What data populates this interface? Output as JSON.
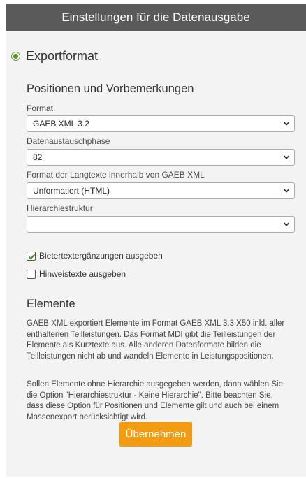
{
  "header": {
    "title": "Einstellungen für die Datenausgabe"
  },
  "export": {
    "radio_label": "Exportformat",
    "section_title": "Positionen und Vorbemerkungen",
    "fields": [
      {
        "label": "Format",
        "value": "GAEB XML 3.2"
      },
      {
        "label": "Datenaustauschphase",
        "value": "82"
      },
      {
        "label": "Format der Langtexte innerhalb von GAEB XML",
        "value": "Unformatiert (HTML)"
      },
      {
        "label": "Hierarchiestruktur",
        "value": ""
      }
    ],
    "checkboxes": [
      {
        "label": "Bietertextergänzungen ausgeben",
        "checked": true
      },
      {
        "label": "Hinweistexte ausgeben",
        "checked": false
      }
    ]
  },
  "elements": {
    "title": "Elemente",
    "paragraph1": "GAEB XML exportiert Elemente im Format GAEB XML 3.3 X50 inkl. aller enthaltenen Teilleistungen. Das Format MDI gibt die Teilleistungen der Elemente als Kurztexte aus. Alle anderen Datenformate bilden die Teilleistungen nicht ab und wandeln Elemente in Leistungspositionen.",
    "paragraph2": "Sollen Elemente ohne Hierarchie ausgegeben werden, dann wählen Sie die Option \"Hierarchiestruktur - Keine Hierarchie\". Bitte beachten Sie, dass diese Option für Positionen und Elemente gilt und auch bei einem Massenexport berücksichtigt wird."
  },
  "apply_button": "Übernehmen",
  "colors": {
    "header_bg": "#5a5a5a",
    "accent": "#f39c12",
    "radio": "#4e9a2a"
  }
}
